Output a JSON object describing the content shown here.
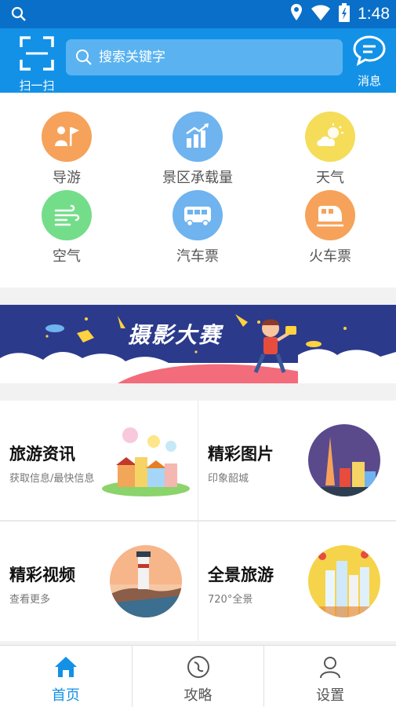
{
  "status_bar": {
    "time": "1:48"
  },
  "header": {
    "scan_label": "扫一扫",
    "search_placeholder": "搜索关键字",
    "message_label": "消息"
  },
  "quick_actions": [
    {
      "label": "导游",
      "icon": "guide-flag-icon",
      "color": "#f6a25a"
    },
    {
      "label": "景区承载量",
      "icon": "chart-up-icon",
      "color": "#6fb3ef"
    },
    {
      "label": "天气",
      "icon": "weather-icon",
      "color": "#f5dd5a"
    },
    {
      "label": "空气",
      "icon": "wind-icon",
      "color": "#74dd8a"
    },
    {
      "label": "汽车票",
      "icon": "bus-icon",
      "color": "#6fb3ef"
    },
    {
      "label": "火车票",
      "icon": "train-icon",
      "color": "#f6a25a"
    }
  ],
  "banner": {
    "title": "摄影大赛"
  },
  "features": [
    {
      "title": "旅游资讯",
      "subtitle": "获取信息/最快信息"
    },
    {
      "title": "精彩图片",
      "subtitle": "印象韶城"
    },
    {
      "title": "精彩视频",
      "subtitle": "查看更多"
    },
    {
      "title": "全景旅游",
      "subtitle": "720°全景"
    }
  ],
  "bottom_nav": [
    {
      "label": "首页",
      "active": true
    },
    {
      "label": "攻略",
      "active": false
    },
    {
      "label": "设置",
      "active": false
    }
  ],
  "colors": {
    "primary": "#1391e6",
    "status_bar": "#0a6fc8"
  }
}
